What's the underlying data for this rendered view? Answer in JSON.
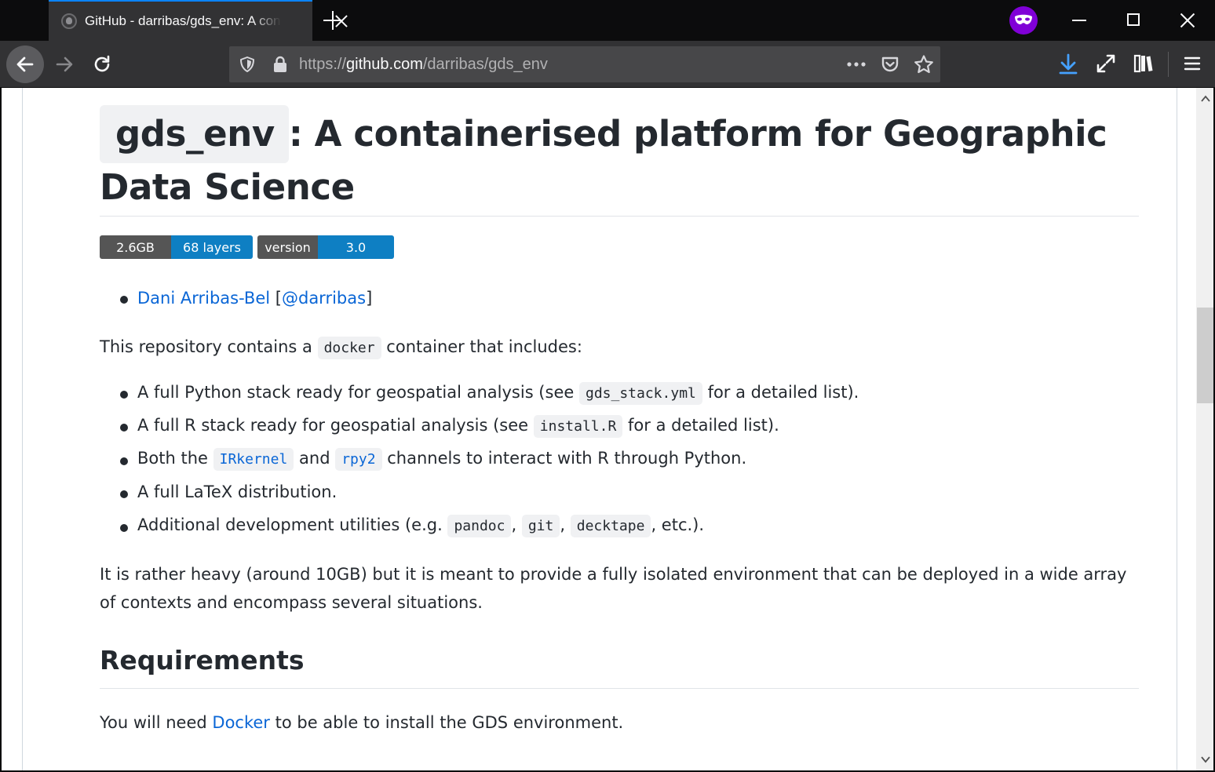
{
  "browser": {
    "tab_title": "GitHub - darribas/gds_env: A containerised platform for Geographic Data Science",
    "url_prefix": "https://",
    "url_host": "github.com",
    "url_path": "/darribas/gds_env",
    "url_more_label": "•••"
  },
  "page": {
    "title_code": "gds_env",
    "title_rest": ": A containerised platform for Geographic Data Science",
    "badges": [
      {
        "left": "2.6GB",
        "right": "68 layers"
      },
      {
        "left": "version",
        "right": "3.0"
      }
    ],
    "author": {
      "name": "Dani Arribas-Bel",
      "open": "[",
      "handle": "@darribas",
      "close": "]"
    },
    "intro": {
      "before": "This repository contains a",
      "code": "docker",
      "after": "container that includes:"
    },
    "features": [
      {
        "before": "A full Python stack ready for geospatial analysis (see",
        "code": "gds_stack.yml",
        "after": "for a detailed list)."
      },
      {
        "before": "A full R stack ready for geospatial analysis (see",
        "code": "install.R",
        "after": "for a detailed list)."
      },
      {
        "before": "Both the",
        "code1": "IRkernel",
        "middle": "and",
        "code2": "rpy2",
        "after": "channels to interact with R through Python."
      },
      {
        "text": "A full LaTeX distribution."
      },
      {
        "before": "Additional development utilities (e.g.",
        "code1": "pandoc",
        "sep1": ",",
        "code2": "git",
        "sep2": ",",
        "code3": "decktape",
        "after": ", etc.)."
      }
    ],
    "heavy_para": {
      "line1": "It is rather heavy (around 10GB) but it is meant to provide a fully isolated environment that can be deployed in a wide array",
      "line2": "of contexts and encompass several situations."
    },
    "requirements": {
      "heading": "Requirements",
      "before": "You will need",
      "link": "Docker",
      "after": "to be able to install the GDS environment."
    }
  },
  "colors": {
    "accent_tab": "#0a84ff",
    "private": "#8000d7",
    "link": "#0a66d6",
    "badge_left": "#555555",
    "badge_right": "#0e7fc3",
    "text": "#24292f"
  }
}
